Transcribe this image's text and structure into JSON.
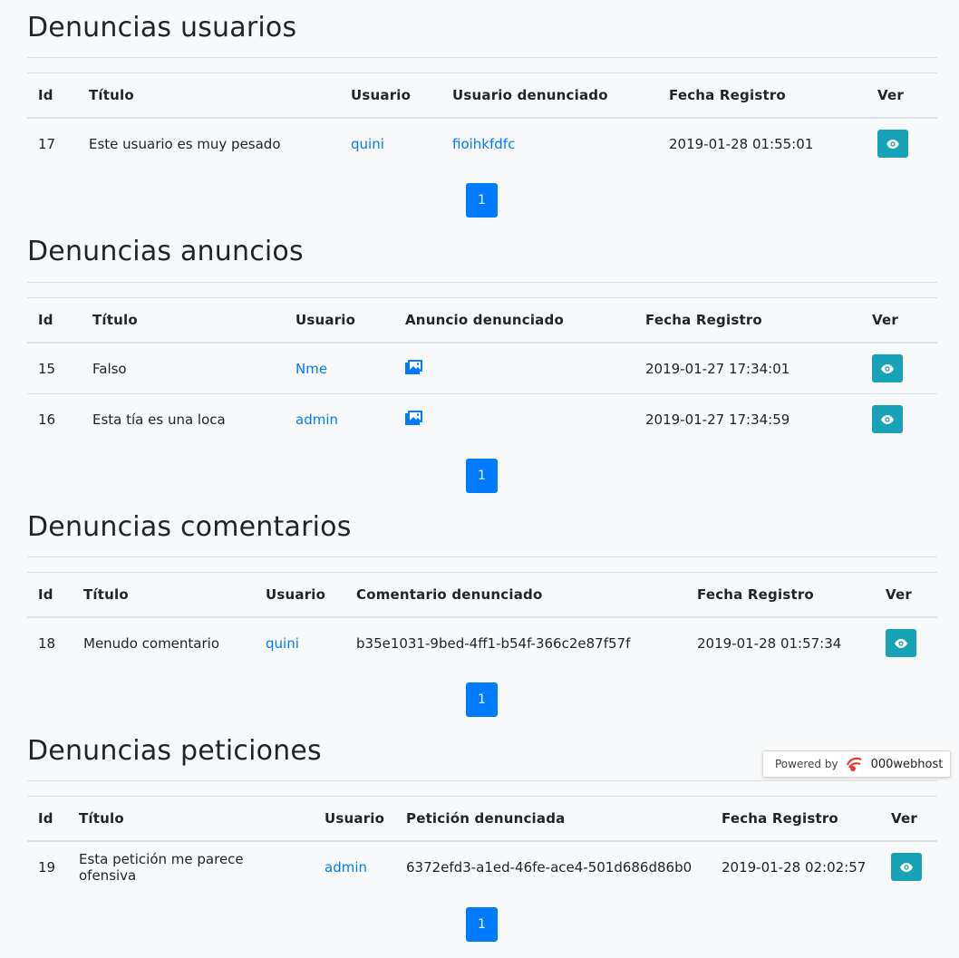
{
  "colors": {
    "primary": "#007bff",
    "info": "#17a2b8",
    "border": "#dee2e6",
    "bg": "#f8f9fa"
  },
  "sections": [
    {
      "title": "Denuncias usuarios",
      "headers": [
        "Id",
        "Título",
        "Usuario",
        "Usuario denunciado",
        "Fecha Registro",
        "Ver"
      ],
      "rows": [
        {
          "id": "17",
          "titulo": "Este usuario es muy pesado",
          "usuario": "quini",
          "denunciado": "fioihkfdfc",
          "fecha": "2019-01-28 01:55:01"
        }
      ],
      "page": "1"
    },
    {
      "title": "Denuncias anuncios",
      "headers": [
        "Id",
        "Título",
        "Usuario",
        "Anuncio denunciado",
        "Fecha Registro",
        "Ver"
      ],
      "rows": [
        {
          "id": "15",
          "titulo": "Falso",
          "usuario": "Nme",
          "denunciado_icon": "image-icon",
          "fecha": "2019-01-27 17:34:01"
        },
        {
          "id": "16",
          "titulo": "Esta tía es una loca",
          "usuario": "admin",
          "denunciado_icon": "image-icon",
          "fecha": "2019-01-27 17:34:59"
        }
      ],
      "page": "1"
    },
    {
      "title": "Denuncias comentarios",
      "headers": [
        "Id",
        "Título",
        "Usuario",
        "Comentario denunciado",
        "Fecha Registro",
        "Ver"
      ],
      "rows": [
        {
          "id": "18",
          "titulo": "Menudo comentario",
          "usuario": "quini",
          "denunciado": "b35e1031-9bed-4ff1-b54f-366c2e87f57f",
          "fecha": "2019-01-28 01:57:34"
        }
      ],
      "page": "1"
    },
    {
      "title": "Denuncias peticiones",
      "headers": [
        "Id",
        "Título",
        "Usuario",
        "Petición denunciada",
        "Fecha Registro",
        "Ver"
      ],
      "rows": [
        {
          "id": "19",
          "titulo": "Esta petición me parece ofensiva",
          "usuario": "admin",
          "denunciado": "6372efd3-a1ed-46fe-ace4-501d686d86b0",
          "fecha": "2019-01-28 02:02:57"
        }
      ],
      "page": "1"
    }
  ],
  "hosting_badge": {
    "powered_by": "Powered by",
    "brand": "000webhost"
  },
  "icons": {
    "view": "eye-icon",
    "ad": "image-icon",
    "brand": "000webhost-logo-icon"
  }
}
